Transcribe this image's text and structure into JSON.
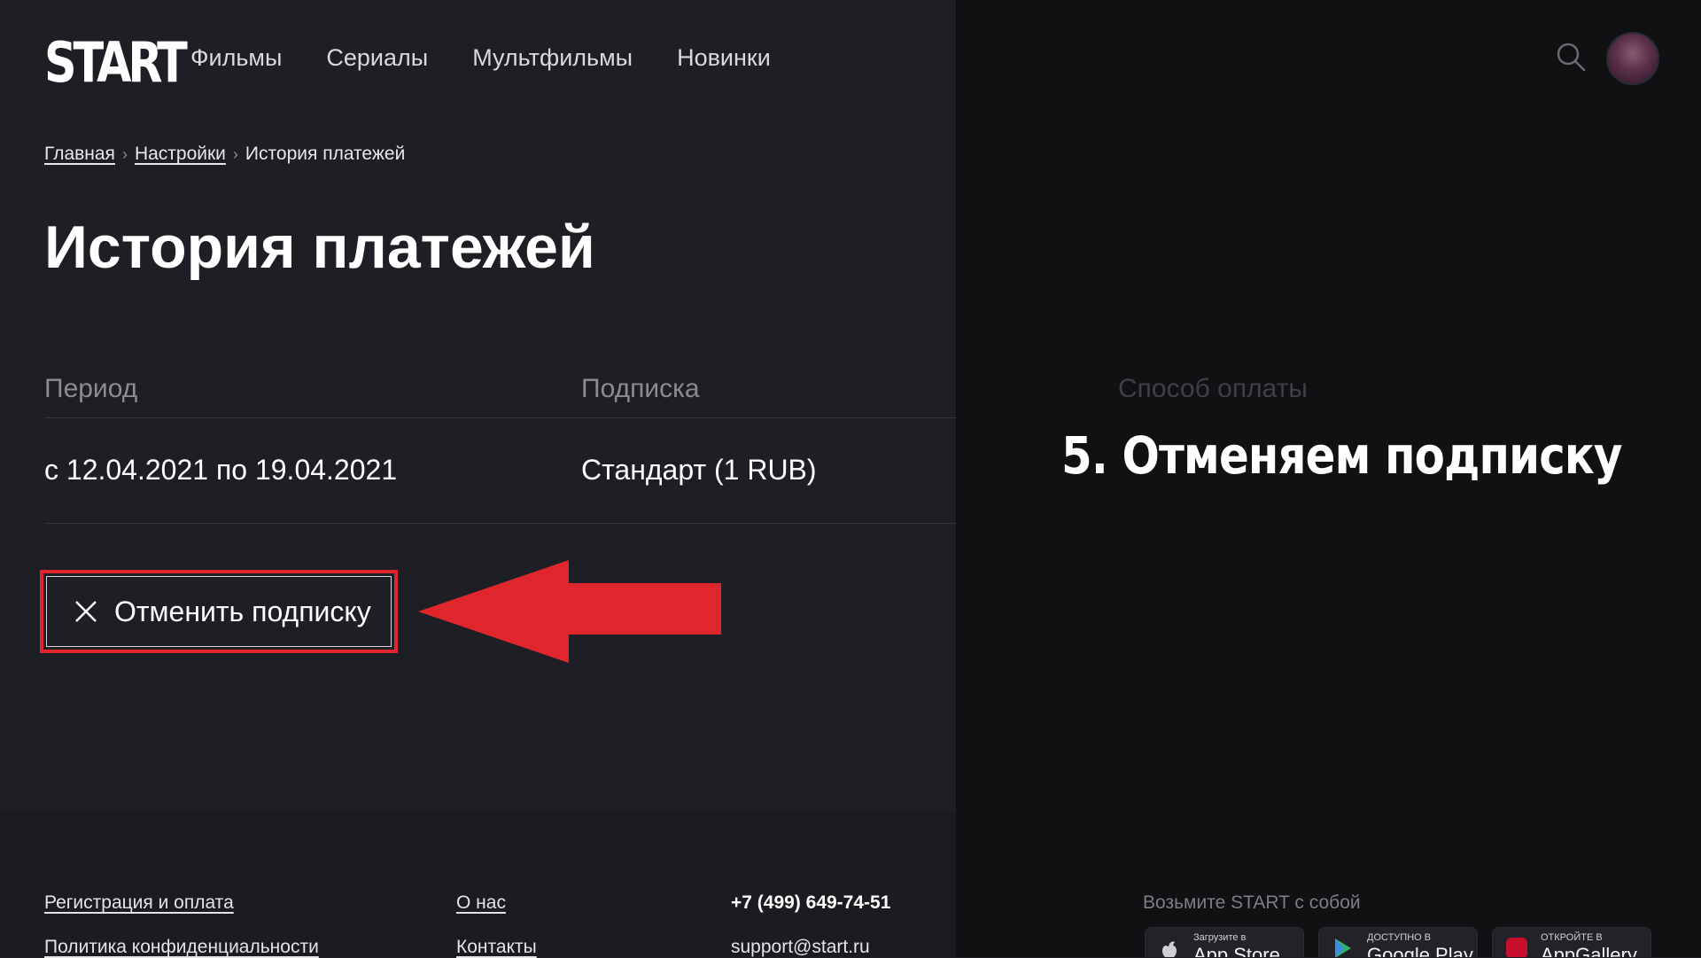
{
  "header": {
    "logo": "START",
    "nav": [
      "Фильмы",
      "Сериалы",
      "Мультфильмы",
      "Новинки"
    ]
  },
  "breadcrumb": {
    "home": "Главная",
    "settings": "Настройки",
    "current": "История платежей",
    "separator": "›"
  },
  "page": {
    "title": "История платежей"
  },
  "table": {
    "headers": [
      "Период",
      "Подписка",
      "Способ оплаты"
    ],
    "rows": [
      {
        "period": "с 12.04.2021 по 19.04.2021",
        "subscription": "Стандарт (1 RUB)"
      }
    ]
  },
  "cancel_button": {
    "label": "Отменить подписку"
  },
  "overlay": {
    "caption": "5. Отменяем подписку"
  },
  "footer": {
    "col1": [
      "Регистрация и оплата",
      "Политика конфиденциальности"
    ],
    "col2": [
      "О нас",
      "Контакты"
    ],
    "phone": "+7 (499) 649-74-51",
    "email": "support@start.ru",
    "apps_title": "Возьмите START с собой",
    "badges": [
      {
        "small": "Загрузите в",
        "big": "App Store"
      },
      {
        "small": "ДОСТУПНО В",
        "big": "Google Play"
      },
      {
        "small": "ОТКРОЙТЕ В",
        "big": "AppGallery"
      }
    ]
  },
  "colors": {
    "accent_red": "#e0262d",
    "background": "#1e1f24",
    "dim_overlay": "#111114"
  }
}
